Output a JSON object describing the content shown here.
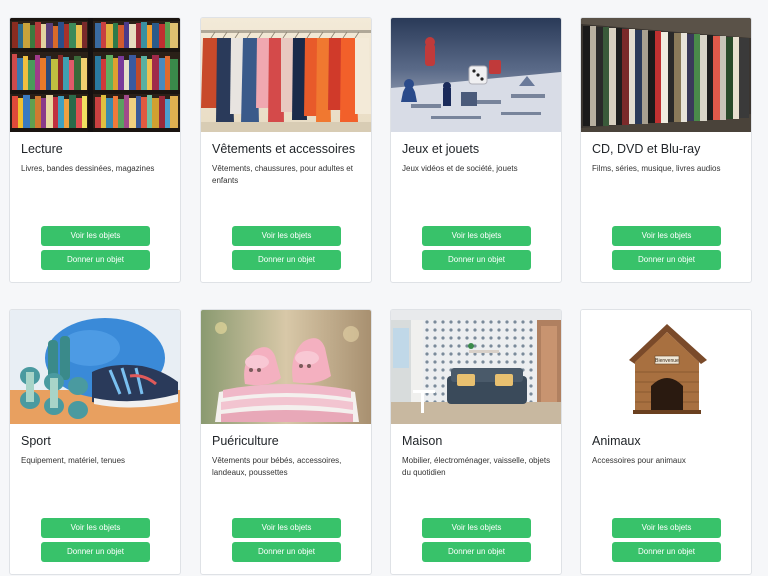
{
  "theme": {
    "accent": "#38c26a",
    "page_bg": "#f6f7f9",
    "card_border": "#dfe2e6"
  },
  "categories": [
    {
      "title": "Lecture",
      "description": "Livres, bandes dessinées, magazines",
      "image_icon": "bookshelf-photo",
      "view_label": "Voir les objets",
      "give_label": "Donner un objet"
    },
    {
      "title": "Vêtements et accessoires",
      "description": "Vêtements, chaussures, pour adultes et enfants",
      "image_icon": "clothes-rack-photo",
      "view_label": "Voir les objets",
      "give_label": "Donner un objet"
    },
    {
      "title": "Jeux et jouets",
      "description": "Jeux vidéos et de société, jouets",
      "image_icon": "board-game-photo",
      "view_label": "Voir les objets",
      "give_label": "Donner un objet"
    },
    {
      "title": "CD, DVD et Blu-ray",
      "description": "Films, séries, musique, livres audios",
      "image_icon": "dvd-shelf-photo",
      "view_label": "Voir les objets",
      "give_label": "Donner un objet"
    },
    {
      "title": "Sport",
      "description": "Equipement, matériel, tenues",
      "image_icon": "sport-equipment-photo",
      "view_label": "Voir les objets",
      "give_label": "Donner un objet"
    },
    {
      "title": "Puériculture",
      "description": "Vêtements pour bébés, accessoires, landeaux, poussettes",
      "image_icon": "baby-booties-photo",
      "view_label": "Voir les objets",
      "give_label": "Donner un objet"
    },
    {
      "title": "Maison",
      "description": "Mobilier, électroménager, vaisselle, objets du quotidien",
      "image_icon": "living-room-photo",
      "view_label": "Voir les objets",
      "give_label": "Donner un objet"
    },
    {
      "title": "Animaux",
      "description": "Accessoires pour animaux",
      "image_icon": "dog-house-photo",
      "image_text": "Bienvenue",
      "view_label": "Voir les objets",
      "give_label": "Donner un objet"
    }
  ]
}
